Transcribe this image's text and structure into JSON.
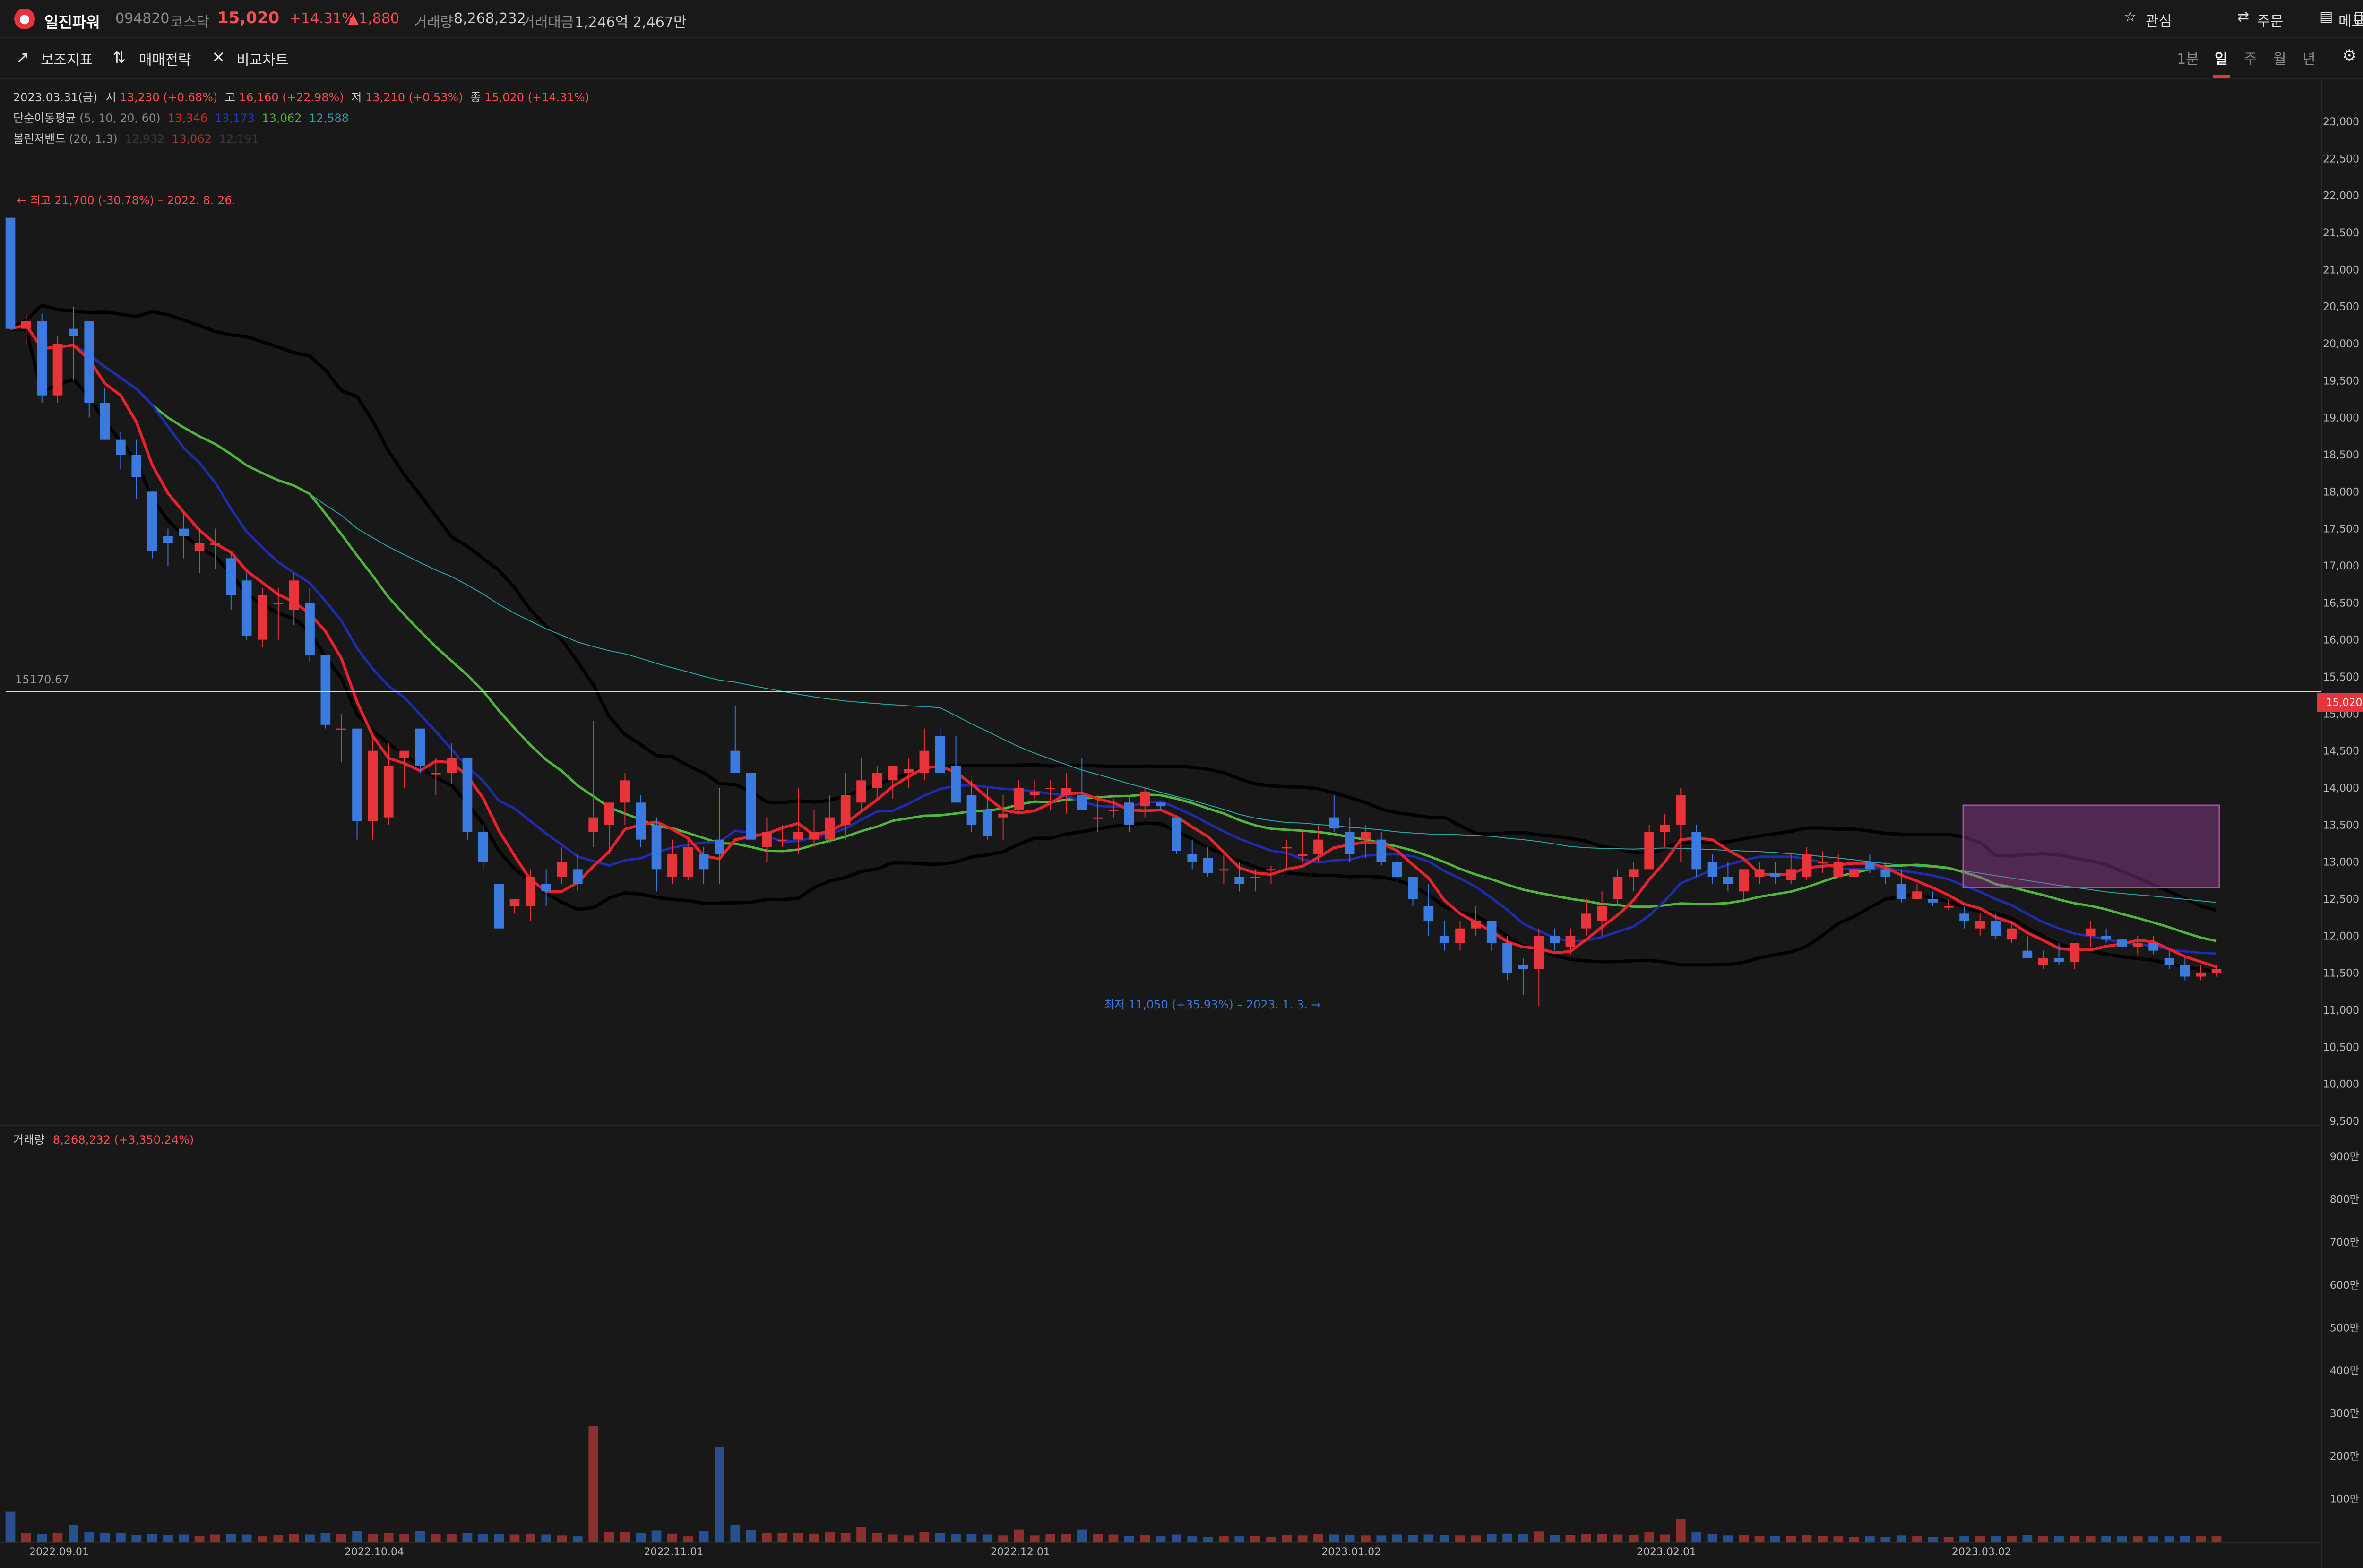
{
  "header": {
    "stock_name": "일진파워",
    "code": "094820",
    "market": "코스닥",
    "price": "15,020",
    "change_pct": "+14.31%",
    "change_abs": "▲1,880",
    "volume_label": "거래량",
    "volume": "8,268,232",
    "amount_label": "거래대금",
    "amount": "1,246억 2,467만",
    "actions": [
      "관심",
      "주문",
      "메모"
    ]
  },
  "toolbar": {
    "items": [
      "보조지표",
      "매매전략",
      "비교차트"
    ],
    "periods": [
      "1분",
      "일",
      "주",
      "월",
      "년"
    ],
    "active_period": "일"
  },
  "legend": {
    "ohlc": {
      "date": "2023.03.31(금)",
      "open_label": "시",
      "open": "13,230 (+0.68%)",
      "high_label": "고",
      "high": "16,160 (+22.98%)",
      "low_label": "저",
      "low": "13,210 (+0.53%)",
      "close_label": "종",
      "close": "15,020 (+14.31%)"
    },
    "sma": {
      "label": "단순이동평균",
      "params": "(5, 10, 20, 60)",
      "v5": "13,346",
      "v10": "13,173",
      "v20": "13,062",
      "v60": "12,588"
    },
    "bollinger": {
      "label": "볼린저밴드",
      "params": "(20, 1.3)",
      "upper": "12,932",
      "mid": "13,062",
      "lower": "12,191"
    }
  },
  "annotations": {
    "high": "← 최고 21,700 (-30.78%) – 2022. 8. 26.",
    "low": "최저 11,050 (+35.93%) – 2023. 1. 3. →",
    "crosshair_value": "15170.67",
    "last_price_tag": "15,020"
  },
  "volume_legend": {
    "label": "거래량",
    "value": "8,268,232 (+3,350.24%)"
  },
  "colors": {
    "up": "#e8333a",
    "down": "#3b7be0",
    "ma5": "#e8222a",
    "ma10": "#1f2bb0",
    "ma20": "#4fb83a",
    "ma60": "#2aa6a6",
    "bb": "#000000",
    "background": "#181818"
  },
  "chart_data": {
    "type": "candlestick",
    "y_axis_ticks": [
      "23,000",
      "22,500",
      "22,000",
      "21,500",
      "21,000",
      "20,500",
      "20,000",
      "19,500",
      "19,000",
      "18,500",
      "18,000",
      "17,500",
      "17,000",
      "16,500",
      "16,000",
      "15,500",
      "15,000",
      "14,500",
      "14,000",
      "13,500",
      "13,000",
      "12,500",
      "12,000",
      "11,500",
      "11,000",
      "10,500",
      "10,000",
      "9,500"
    ],
    "y_range": [
      9500,
      23300
    ],
    "volume_ticks": [
      "900만",
      "800만",
      "700만",
      "600만",
      "500만",
      "400만",
      "300만",
      "200만",
      "100만"
    ],
    "volume_range": [
      0,
      9300000
    ],
    "x_labels": [
      {
        "label": "2022.09.01",
        "index": 3
      },
      {
        "label": "2022.10.04",
        "index": 23
      },
      {
        "label": "2022.11.01",
        "index": 42
      },
      {
        "label": "2022.12.01",
        "index": 64
      },
      {
        "label": "2023.01.02",
        "index": 85
      },
      {
        "label": "2023.02.01",
        "index": 105
      },
      {
        "label": "2023.03.02",
        "index": 125
      }
    ],
    "candles": [
      [
        21700,
        21700,
        20200,
        20200,
        700000
      ],
      [
        20200,
        20400,
        20000,
        20300,
        200000
      ],
      [
        20300,
        20400,
        19200,
        19300,
        180000
      ],
      [
        19300,
        20100,
        19200,
        20000,
        210000
      ],
      [
        20200,
        20500,
        19500,
        20100,
        380000
      ],
      [
        20300,
        20300,
        19000,
        19200,
        220000
      ],
      [
        19200,
        19400,
        18700,
        18700,
        200000
      ],
      [
        18700,
        18800,
        18300,
        18500,
        200000
      ],
      [
        18500,
        18700,
        17900,
        18200,
        150000
      ],
      [
        18000,
        18000,
        17100,
        17200,
        180000
      ],
      [
        17400,
        17500,
        17000,
        17300,
        150000
      ],
      [
        17500,
        17700,
        17100,
        17400,
        160000
      ],
      [
        17200,
        17500,
        16900,
        17300,
        130000
      ],
      [
        17300,
        17500,
        16950,
        17300,
        160000
      ],
      [
        17100,
        17200,
        16400,
        16600,
        170000
      ],
      [
        16800,
        16900,
        16000,
        16050,
        160000
      ],
      [
        16000,
        16700,
        15900,
        16600,
        120000
      ],
      [
        16500,
        16700,
        16000,
        16500,
        150000
      ],
      [
        16400,
        16900,
        16200,
        16800,
        170000
      ],
      [
        16500,
        16700,
        15700,
        15800,
        160000
      ],
      [
        15800,
        15800,
        14800,
        14850,
        200000
      ],
      [
        14800,
        15000,
        14350,
        14800,
        170000
      ],
      [
        14800,
        14800,
        13300,
        13550,
        250000
      ],
      [
        13550,
        14700,
        13300,
        14500,
        180000
      ],
      [
        13600,
        14600,
        13500,
        14300,
        210000
      ],
      [
        14400,
        14500,
        14000,
        14500,
        180000
      ],
      [
        14800,
        14800,
        14200,
        14300,
        250000
      ],
      [
        14200,
        14400,
        13900,
        14200,
        180000
      ],
      [
        14200,
        14600,
        14050,
        14400,
        170000
      ],
      [
        14400,
        14400,
        13300,
        13400,
        200000
      ],
      [
        13400,
        13500,
        12900,
        13000,
        180000
      ],
      [
        12700,
        12700,
        12100,
        12100,
        170000
      ],
      [
        12400,
        12500,
        12300,
        12500,
        160000
      ],
      [
        12400,
        12900,
        12200,
        12800,
        190000
      ],
      [
        12700,
        12900,
        12400,
        12600,
        160000
      ],
      [
        12800,
        13200,
        12700,
        13000,
        140000
      ],
      [
        12900,
        13100,
        12600,
        12700,
        120000
      ],
      [
        13400,
        14900,
        13200,
        13600,
        2700000
      ],
      [
        13500,
        13800,
        13100,
        13800,
        230000
      ],
      [
        13800,
        14200,
        13500,
        14100,
        220000
      ],
      [
        13800,
        13900,
        13200,
        13300,
        200000
      ],
      [
        13500,
        13600,
        12600,
        12900,
        260000
      ],
      [
        12800,
        13300,
        12700,
        13100,
        190000
      ],
      [
        12800,
        13300,
        12750,
        13200,
        120000
      ],
      [
        13100,
        13200,
        12700,
        12900,
        250000
      ],
      [
        13300,
        14000,
        12700,
        13100,
        2200000
      ],
      [
        14500,
        15100,
        14300,
        14200,
        380000
      ],
      [
        14200,
        14200,
        13400,
        13300,
        270000
      ],
      [
        13200,
        13600,
        13000,
        13400,
        200000
      ],
      [
        13300,
        13500,
        13200,
        13300,
        200000
      ],
      [
        13300,
        14000,
        13100,
        13400,
        210000
      ],
      [
        13300,
        13700,
        13200,
        13400,
        190000
      ],
      [
        13300,
        13900,
        13250,
        13600,
        220000
      ],
      [
        13500,
        14200,
        13300,
        13900,
        200000
      ],
      [
        13800,
        14400,
        13700,
        14100,
        340000
      ],
      [
        14000,
        14300,
        13850,
        14200,
        210000
      ],
      [
        14100,
        14300,
        13850,
        14300,
        160000
      ],
      [
        14200,
        14400,
        14000,
        14250,
        140000
      ],
      [
        14200,
        14800,
        14100,
        14500,
        230000
      ],
      [
        14700,
        14800,
        14200,
        14200,
        200000
      ],
      [
        14300,
        14700,
        13800,
        13800,
        180000
      ],
      [
        13900,
        14100,
        13400,
        13500,
        170000
      ],
      [
        13700,
        14000,
        13300,
        13350,
        160000
      ],
      [
        13600,
        13900,
        13300,
        13650,
        140000
      ],
      [
        13700,
        14100,
        13650,
        14000,
        280000
      ],
      [
        13900,
        14100,
        13850,
        13950,
        140000
      ],
      [
        14000,
        14100,
        13700,
        14000,
        170000
      ],
      [
        13900,
        14200,
        13650,
        14000,
        180000
      ],
      [
        13900,
        14400,
        13800,
        13700,
        280000
      ],
      [
        13600,
        13900,
        13400,
        13600,
        180000
      ],
      [
        13700,
        13850,
        13600,
        13700,
        160000
      ],
      [
        13800,
        13900,
        13400,
        13500,
        130000
      ],
      [
        13750,
        14000,
        13600,
        13950,
        150000
      ],
      [
        13800,
        13800,
        13700,
        13750,
        120000
      ],
      [
        13600,
        13600,
        13100,
        13150,
        160000
      ],
      [
        13100,
        13300,
        12900,
        13000,
        120000
      ],
      [
        13050,
        13200,
        12800,
        12850,
        110000
      ],
      [
        12900,
        13100,
        12700,
        12900,
        120000
      ],
      [
        12800,
        13000,
        12600,
        12700,
        120000
      ],
      [
        12800,
        12900,
        12600,
        12800,
        130000
      ],
      [
        12900,
        12950,
        12700,
        12900,
        110000
      ],
      [
        13200,
        13300,
        12900,
        13200,
        150000
      ],
      [
        13100,
        13400,
        13000,
        13100,
        140000
      ],
      [
        13100,
        13500,
        13000,
        13300,
        170000
      ],
      [
        13600,
        13900,
        13400,
        13450,
        160000
      ],
      [
        13400,
        13600,
        13000,
        13100,
        150000
      ],
      [
        13300,
        13500,
        13050,
        13400,
        140000
      ],
      [
        13300,
        13400,
        12950,
        13000,
        140000
      ],
      [
        13000,
        13200,
        12700,
        12800,
        160000
      ],
      [
        12800,
        12800,
        12400,
        12500,
        150000
      ],
      [
        12400,
        12700,
        12000,
        12200,
        160000
      ],
      [
        12000,
        12200,
        11800,
        11900,
        150000
      ],
      [
        11900,
        12200,
        11800,
        12100,
        140000
      ],
      [
        12100,
        12400,
        12000,
        12200,
        140000
      ],
      [
        12200,
        12200,
        11800,
        11900,
        180000
      ],
      [
        11900,
        12000,
        11400,
        11500,
        190000
      ],
      [
        11600,
        11700,
        11200,
        11550,
        170000
      ],
      [
        11550,
        12100,
        11050,
        12000,
        240000
      ],
      [
        12000,
        12100,
        11800,
        11900,
        150000
      ],
      [
        11850,
        12100,
        11750,
        12000,
        150000
      ],
      [
        12100,
        12500,
        12000,
        12300,
        170000
      ],
      [
        12200,
        12600,
        12000,
        12400,
        180000
      ],
      [
        12500,
        12900,
        12400,
        12800,
        160000
      ],
      [
        12800,
        13000,
        12600,
        12900,
        150000
      ],
      [
        12900,
        13500,
        12900,
        13400,
        220000
      ],
      [
        13400,
        13650,
        13200,
        13500,
        160000
      ],
      [
        13500,
        14000,
        13000,
        13900,
        520000
      ],
      [
        13400,
        13500,
        12800,
        12900,
        220000
      ],
      [
        13000,
        13100,
        12700,
        12800,
        180000
      ],
      [
        12800,
        13000,
        12600,
        12700,
        140000
      ],
      [
        12600,
        12900,
        12500,
        12900,
        150000
      ],
      [
        12800,
        13000,
        12700,
        12900,
        130000
      ],
      [
        12850,
        13000,
        12700,
        12800,
        130000
      ],
      [
        12750,
        13100,
        12700,
        12900,
        130000
      ],
      [
        12800,
        13200,
        12750,
        13100,
        150000
      ],
      [
        13000,
        13150,
        12850,
        13000,
        130000
      ],
      [
        12800,
        13100,
        12800,
        13000,
        120000
      ],
      [
        12800,
        13000,
        12800,
        12900,
        110000
      ],
      [
        13000,
        13100,
        12850,
        12900,
        120000
      ],
      [
        12900,
        13000,
        12700,
        12800,
        110000
      ],
      [
        12700,
        12900,
        12450,
        12500,
        140000
      ],
      [
        12500,
        12700,
        12500,
        12600,
        120000
      ],
      [
        12500,
        12600,
        12400,
        12450,
        110000
      ],
      [
        12400,
        12500,
        12350,
        12400,
        110000
      ],
      [
        12300,
        12400,
        12100,
        12200,
        130000
      ],
      [
        12100,
        12300,
        12000,
        12200,
        120000
      ],
      [
        12200,
        12300,
        11950,
        12000,
        120000
      ],
      [
        11950,
        12200,
        11900,
        12100,
        120000
      ],
      [
        11800,
        12000,
        11700,
        11700,
        150000
      ],
      [
        11600,
        11800,
        11550,
        11700,
        130000
      ],
      [
        11700,
        11900,
        11600,
        11650,
        130000
      ],
      [
        11650,
        11900,
        11550,
        11900,
        130000
      ],
      [
        12000,
        12200,
        11850,
        12100,
        120000
      ],
      [
        12000,
        12100,
        11900,
        11950,
        130000
      ],
      [
        11950,
        12100,
        11800,
        11850,
        120000
      ],
      [
        11850,
        12000,
        11750,
        11900,
        120000
      ],
      [
        11900,
        12000,
        11750,
        11800,
        120000
      ],
      [
        11700,
        11800,
        11550,
        11600,
        120000
      ],
      [
        11600,
        11700,
        11400,
        11450,
        130000
      ],
      [
        11450,
        11600,
        11400,
        11500,
        120000
      ],
      [
        11500,
        11600,
        11450,
        11550,
        120000
      ]
    ]
  }
}
